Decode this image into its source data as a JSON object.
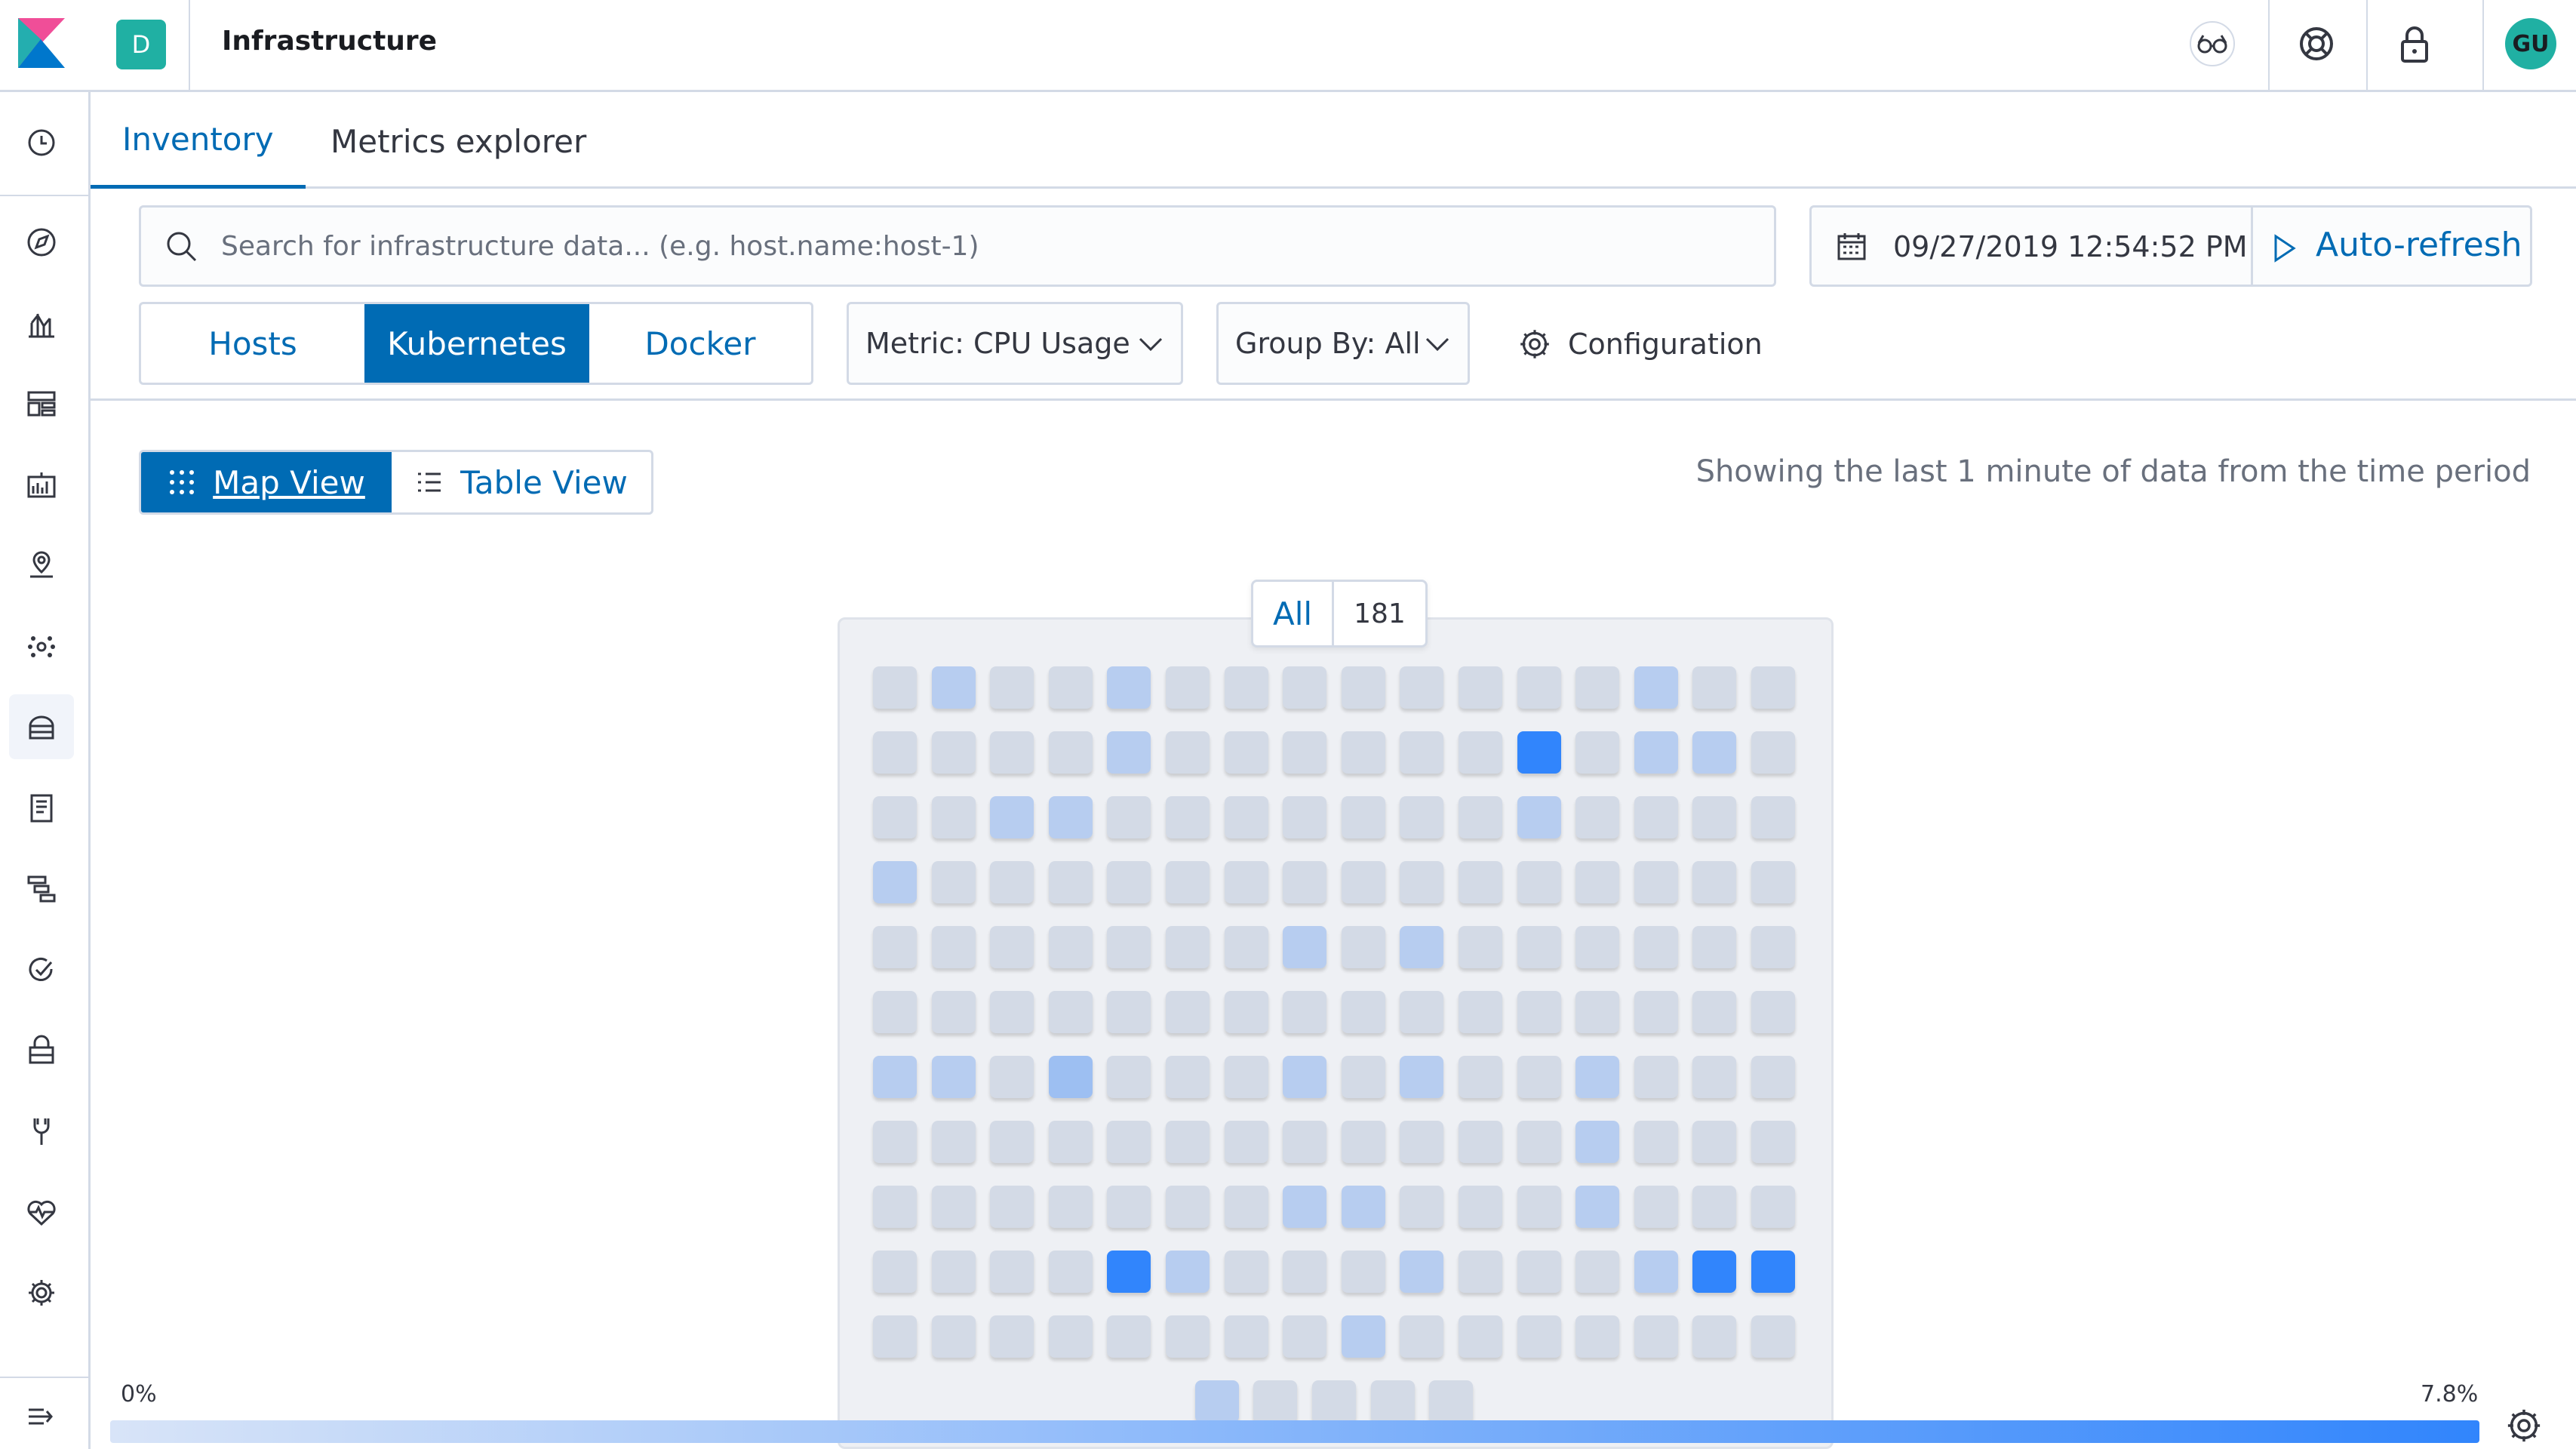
{
  "header": {
    "space_initial": "D",
    "app_title": "Infrastructure",
    "avatar_initials": "GU",
    "icons": [
      "glasses-icon",
      "help-icon",
      "lock-icon"
    ]
  },
  "sidebar": {
    "items": [
      {
        "name": "recently-viewed",
        "icon": "clock-icon"
      },
      {
        "name": "discover",
        "icon": "compass-icon"
      },
      {
        "name": "visualize",
        "icon": "chart-icon"
      },
      {
        "name": "dashboard",
        "icon": "dashboard-icon"
      },
      {
        "name": "canvas",
        "icon": "canvas-icon"
      },
      {
        "name": "maps",
        "icon": "map-pin-icon"
      },
      {
        "name": "machine-learning",
        "icon": "ml-icon"
      },
      {
        "name": "infrastructure",
        "icon": "infrastructure-icon",
        "active": true
      },
      {
        "name": "logs",
        "icon": "logs-icon"
      },
      {
        "name": "apm",
        "icon": "apm-icon"
      },
      {
        "name": "uptime",
        "icon": "uptime-icon"
      },
      {
        "name": "siem",
        "icon": "siem-icon"
      },
      {
        "name": "dev-tools",
        "icon": "wrench-icon"
      },
      {
        "name": "monitoring",
        "icon": "heartbeat-icon"
      },
      {
        "name": "management",
        "icon": "gear-icon"
      }
    ],
    "collapse_icon": "collapse-icon"
  },
  "tabs": [
    {
      "label": "Inventory",
      "active": true
    },
    {
      "label": "Metrics explorer",
      "active": false
    }
  ],
  "search": {
    "placeholder": "Search for infrastructure data... (e.g. host.name:host-1)"
  },
  "datepicker": {
    "date": "09/27/2019 12:54:52 PM",
    "refresh_label": "Auto-refresh"
  },
  "node_types": [
    {
      "label": "Hosts",
      "selected": false
    },
    {
      "label": "Kubernetes",
      "selected": true
    },
    {
      "label": "Docker",
      "selected": false
    }
  ],
  "metric_dropdown": {
    "label": "Metric: CPU Usage"
  },
  "groupby_dropdown": {
    "label": "Group By: All"
  },
  "configuration_label": "Configuration",
  "view_toggle": {
    "map_label": "Map View",
    "table_label": "Table View",
    "selected": "map"
  },
  "info_text": "Showing the last 1 minute of data from the time period",
  "map": {
    "group_name": "All",
    "group_count": "181",
    "columns": 16,
    "node_levels": [
      0,
      1,
      0,
      0,
      1,
      0,
      0,
      0,
      0,
      0,
      0,
      0,
      0,
      1,
      0,
      0,
      0,
      0,
      0,
      0,
      1,
      0,
      0,
      0,
      0,
      0,
      0,
      3,
      0,
      1,
      1,
      0,
      0,
      0,
      1,
      1,
      0,
      0,
      0,
      0,
      0,
      0,
      0,
      1,
      0,
      0,
      0,
      0,
      1,
      0,
      0,
      0,
      0,
      0,
      0,
      0,
      0,
      0,
      0,
      0,
      0,
      0,
      0,
      0,
      0,
      0,
      0,
      0,
      0,
      0,
      0,
      1,
      0,
      1,
      0,
      0,
      0,
      0,
      0,
      0,
      0,
      0,
      0,
      0,
      0,
      0,
      0,
      0,
      0,
      0,
      0,
      0,
      0,
      0,
      0,
      0,
      1,
      1,
      0,
      2,
      0,
      0,
      0,
      1,
      0,
      1,
      0,
      0,
      1,
      0,
      0,
      0,
      0,
      0,
      0,
      0,
      0,
      0,
      0,
      0,
      0,
      0,
      0,
      0,
      1,
      0,
      0,
      0,
      0,
      0,
      0,
      0,
      0,
      0,
      0,
      1,
      1,
      0,
      0,
      0,
      1,
      0,
      0,
      0,
      0,
      0,
      0,
      0,
      3,
      1,
      0,
      0,
      0,
      1,
      0,
      0,
      0,
      1,
      3,
      3,
      0,
      0,
      0,
      0,
      0,
      0,
      0,
      0,
      1,
      0,
      0,
      0,
      0,
      0,
      0,
      0,
      1,
      0,
      0,
      0,
      0
    ],
    "level_colors": [
      "#d3dae6",
      "#b7cdf0",
      "#9dbff2",
      "#3185fc"
    ]
  },
  "legend": {
    "min_label": "0%",
    "max_label": "7.8%",
    "color_from": "#d8e4f8",
    "color_to": "#3185fc"
  }
}
